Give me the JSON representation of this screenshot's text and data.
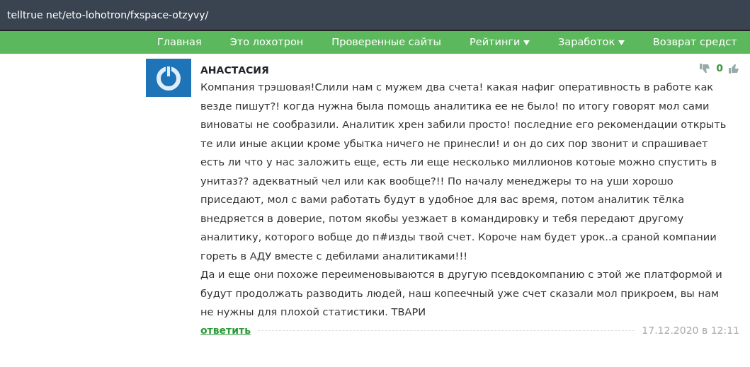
{
  "address_bar": {
    "url": "telltrue net/eto-lohotron/fxspace-otzyvy/"
  },
  "nav": {
    "items": [
      {
        "label": "Главная",
        "dropdown": false
      },
      {
        "label": "Это лохотрон",
        "dropdown": false
      },
      {
        "label": "Проверенные сайты",
        "dropdown": false
      },
      {
        "label": "Рейтинги",
        "dropdown": true
      },
      {
        "label": "Заработок",
        "dropdown": true
      },
      {
        "label": "Возврат средст",
        "dropdown": false
      }
    ]
  },
  "comment": {
    "author": "АНАСТАСИЯ",
    "score": "0",
    "paragraphs": [
      "Компания трэшовая!Слили нам с мужем два счета! какая нафиг оперативность в работе как везде пишут?! когда нужна была помощь аналитика ее не было! по итогу говорят мол сами виноваты не сообразили. Аналитик хрен забили просто! последние его рекомендации открыть те или иные акции кроме убытка ничего не принесли! и он до сих пор звонит и спрашивает есть ли что у нас заложить еще, есть ли еще несколько миллионов котоые можно спустить в унитаз?? адекватный чел или как вообще?!! По началу менеджеры то на уши хорошо приседают, мол с вами работать будут в удобное для вас время, потом аналитик тёлка внедряется в доверие, потом якобы уезжает в командировку и тебя передают другому аналитику, которого вобще до п#изды твой счет. Короче нам будет урок..а сраной компании гореть в АДУ вместе с дебилами аналитиками!!!",
      "Да и еще они похоже переименовываются в другую псевдокомпанию с этой же платформой и будут продолжать разводить людей, наш копеечный уже счет сказали мол прикроем, вы нам не нужны для плохой статистики. ТВАРИ"
    ],
    "reply_link": "ответить",
    "date": "17.12.2020 в 12:11"
  }
}
